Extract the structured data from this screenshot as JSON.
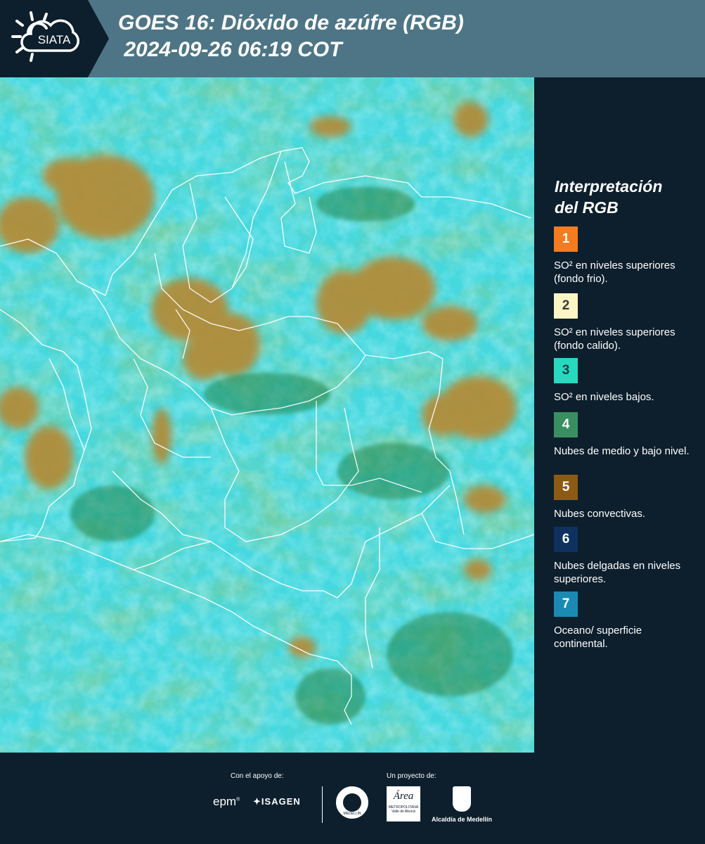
{
  "header": {
    "logo_text": "SIATA",
    "title_line1": "GOES 16: Dióxido de azúfre (RGB)",
    "title_line2": " 2024-09-26 06:19 COT"
  },
  "legend": {
    "title_line1": "Interpretación",
    "title_line2": "del RGB",
    "items": [
      {
        "number": "1",
        "color": "#f47b20",
        "number_color": "#ffffff",
        "text": "SO² en niveles superiores (fondo frio)."
      },
      {
        "number": "2",
        "color": "#fdf5c4",
        "number_color": "#3a3a3a",
        "text": "SO² en niveles superiores (fondo calido)."
      },
      {
        "number": "3",
        "color": "#27d9be",
        "number_color": "#1c3b45",
        "text": "SO² en niveles bajos."
      },
      {
        "number": "4",
        "color": "#3a8f61",
        "number_color": "#ffffff",
        "text": "Nubes de medio y bajo nivel."
      },
      {
        "number": "5",
        "color": "#8c5a14",
        "number_color": "#ffffff",
        "text": "Nubes convectivas."
      },
      {
        "number": "6",
        "color": "#0e3160",
        "number_color": "#ffffff",
        "text": "Nubes delgadas en niveles superiores."
      },
      {
        "number": "7",
        "color": "#1b8ab3",
        "number_color": "#ffffff",
        "text": "Oceano/ superficie continental."
      }
    ]
  },
  "footer": {
    "support_label": "Con el apoyo de:",
    "project_label": "Un proyecto de:",
    "epm_text": "epm",
    "isagen_text": "ISAGEN",
    "area_text": "Área",
    "metro_text": "METROPOLITANA",
    "valle_text": "Valle de Aburrá",
    "alcaldia_text": "Alcaldía de Medellín",
    "seal_text": "MEDELLÍN"
  },
  "colors": {
    "header_bg": "#4e7585",
    "logo_bg": "#0d1f2d",
    "page_bg": "#0d1f2d",
    "cyan": "#3fd9e0",
    "green": "#2f9a55",
    "orange": "#b08a2e"
  }
}
